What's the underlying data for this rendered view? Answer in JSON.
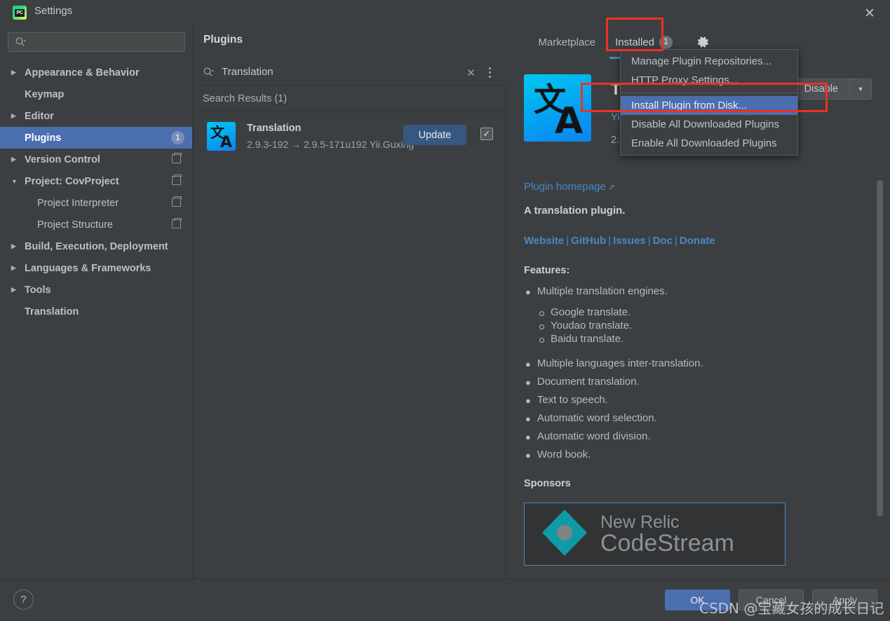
{
  "window": {
    "title": "Settings",
    "logo_icon": "pycharm-logo-icon",
    "logo_text": "PC",
    "close_icon": "close-icon"
  },
  "sidebar": {
    "search": {
      "placeholder": "",
      "value": "",
      "icon": "search-icon"
    },
    "items": [
      {
        "label": "Appearance & Behavior",
        "arrow": "▶",
        "bold": true,
        "indent": false,
        "selected": false,
        "copy": false,
        "badge": ""
      },
      {
        "label": "Keymap",
        "arrow": "",
        "bold": true,
        "indent": false,
        "selected": false,
        "copy": false,
        "badge": ""
      },
      {
        "label": "Editor",
        "arrow": "▶",
        "bold": true,
        "indent": false,
        "selected": false,
        "copy": false,
        "badge": ""
      },
      {
        "label": "Plugins",
        "arrow": "",
        "bold": true,
        "indent": false,
        "selected": true,
        "copy": false,
        "badge": "1"
      },
      {
        "label": "Version Control",
        "arrow": "▶",
        "bold": true,
        "indent": false,
        "selected": false,
        "copy": true,
        "badge": ""
      },
      {
        "label": "Project: CovProject",
        "arrow": "▼",
        "bold": true,
        "indent": false,
        "selected": false,
        "copy": true,
        "badge": ""
      },
      {
        "label": "Project Interpreter",
        "arrow": "",
        "bold": false,
        "indent": true,
        "selected": false,
        "copy": true,
        "badge": ""
      },
      {
        "label": "Project Structure",
        "arrow": "",
        "bold": false,
        "indent": true,
        "selected": false,
        "copy": true,
        "badge": ""
      },
      {
        "label": "Build, Execution, Deployment",
        "arrow": "▶",
        "bold": true,
        "indent": false,
        "selected": false,
        "copy": false,
        "badge": ""
      },
      {
        "label": "Languages & Frameworks",
        "arrow": "▶",
        "bold": true,
        "indent": false,
        "selected": false,
        "copy": false,
        "badge": ""
      },
      {
        "label": "Tools",
        "arrow": "▶",
        "bold": true,
        "indent": false,
        "selected": false,
        "copy": false,
        "badge": ""
      },
      {
        "label": "Translation",
        "arrow": "",
        "bold": true,
        "indent": false,
        "selected": false,
        "copy": false,
        "badge": ""
      }
    ]
  },
  "plugins_page": {
    "title": "Plugins",
    "tabs": [
      {
        "label": "Marketplace",
        "badge": "",
        "active": false
      },
      {
        "label": "Installed",
        "badge": "1",
        "active": true
      }
    ],
    "gear_icon": "gear-icon",
    "search": {
      "icon": "search-icon",
      "value": "Translation",
      "clear_icon": "close-icon",
      "more_icon": "more-vertical-icon"
    },
    "results_header": "Search Results (1)",
    "rows": [
      {
        "icon": "translation-plugin-icon",
        "name": "Translation",
        "subtitle": "2.9.3-192 → 2.9.5-171u192   Yii.Guxing",
        "action_label": "Update",
        "checked": true,
        "check_glyph": "✓"
      }
    ]
  },
  "detail": {
    "icon": "translation-plugin-icon",
    "title": "Translation",
    "vendor": "Yii.Guxing",
    "version_line": "2.9.5-171u192   2022",
    "disable_label": "Disable",
    "disable_arrow_icon": "chevron-down-icon",
    "homepage_label": "Plugin homepage",
    "homepage_ext_icon": "external-link-icon",
    "description": "A translation plugin.",
    "links": [
      "Website",
      "GitHub",
      "Issues",
      "Doc",
      "Donate"
    ],
    "link_separator": "|",
    "features_title": "Features:",
    "features": [
      {
        "text": "Multiple translation engines.",
        "sub": [
          "Google translate.",
          "Youdao translate.",
          "Baidu translate."
        ]
      },
      {
        "text": "Multiple languages inter-translation.",
        "sub": []
      },
      {
        "text": "Document translation.",
        "sub": []
      },
      {
        "text": "Text to speech.",
        "sub": []
      },
      {
        "text": "Automatic word selection.",
        "sub": []
      },
      {
        "text": "Automatic word division.",
        "sub": []
      },
      {
        "text": "Word book.",
        "sub": []
      }
    ],
    "sponsors_title": "Sponsors",
    "sponsor": {
      "logo_icon": "new-relic-logo-icon",
      "line1": "New Relic",
      "line2": "CodeStream"
    }
  },
  "menu": {
    "items": [
      {
        "label": "Manage Plugin Repositories...",
        "selected": false,
        "separator_before": false
      },
      {
        "label": "HTTP Proxy Settings...",
        "selected": false,
        "separator_before": false
      },
      {
        "label": "Install Plugin from Disk...",
        "selected": true,
        "separator_before": true
      },
      {
        "label": "Disable All Downloaded Plugins",
        "selected": false,
        "separator_before": false
      },
      {
        "label": "Enable All Downloaded Plugins",
        "selected": false,
        "separator_before": false
      }
    ]
  },
  "footer": {
    "help_label": "?",
    "ok_label": "OK",
    "cancel_label": "Cancel",
    "apply_label": "Apply"
  },
  "watermark": "CSDN @宝藏女孩的成长日记",
  "colors": {
    "background": "#3c3f41",
    "selection_blue": "#4b6eaf",
    "accent_blue": "#4a88c7",
    "link_blue": "#5b93d6",
    "highlight_red": "#ee3124",
    "button_blue": "#365880",
    "plugin_icon_from": "#00c8f0",
    "plugin_icon_to": "#0b83f0",
    "new_relic_teal": "#0f9aa8"
  }
}
